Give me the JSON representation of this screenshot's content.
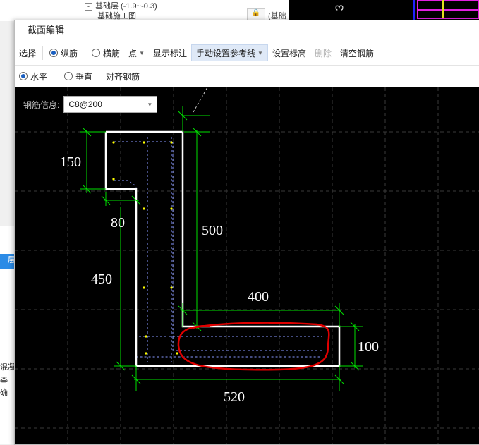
{
  "background": {
    "tree_node": "基础层 (-1.9~-0.3)",
    "tree_node_toggle": "-",
    "tree_child": "基础施工图",
    "column_text": "(基础",
    "dark_label": "3",
    "left_panel_tab": "层",
    "left_text_1": "混凝土",
    "left_text_2": "全 确"
  },
  "dialog": {
    "title": "截面编辑"
  },
  "toolbar": {
    "select": "选择",
    "longitudinal": "纵筋",
    "transverse": "横筋",
    "point": "点",
    "show_dims": "显示标注",
    "manual_ref": "手动设置参考线",
    "set_elevation": "设置标高",
    "delete": "删除",
    "clear_rebar": "清空钢筋"
  },
  "toolbar2": {
    "horizontal": "水平",
    "vertical": "垂直",
    "align_rebar": "对齐钢筋"
  },
  "rebar_info": {
    "label": "钢筋信息:",
    "value": "C8@200"
  },
  "dimensions": {
    "d150": "150",
    "d80": "80",
    "d500": "500",
    "d450": "450",
    "d400": "400",
    "d100": "100",
    "d520": "520"
  },
  "colors": {
    "canvas_bg": "#000000",
    "dim_lines": "#00e000",
    "outline": "#ffffff",
    "highlight": "#e00000",
    "points": "#ffff00"
  }
}
